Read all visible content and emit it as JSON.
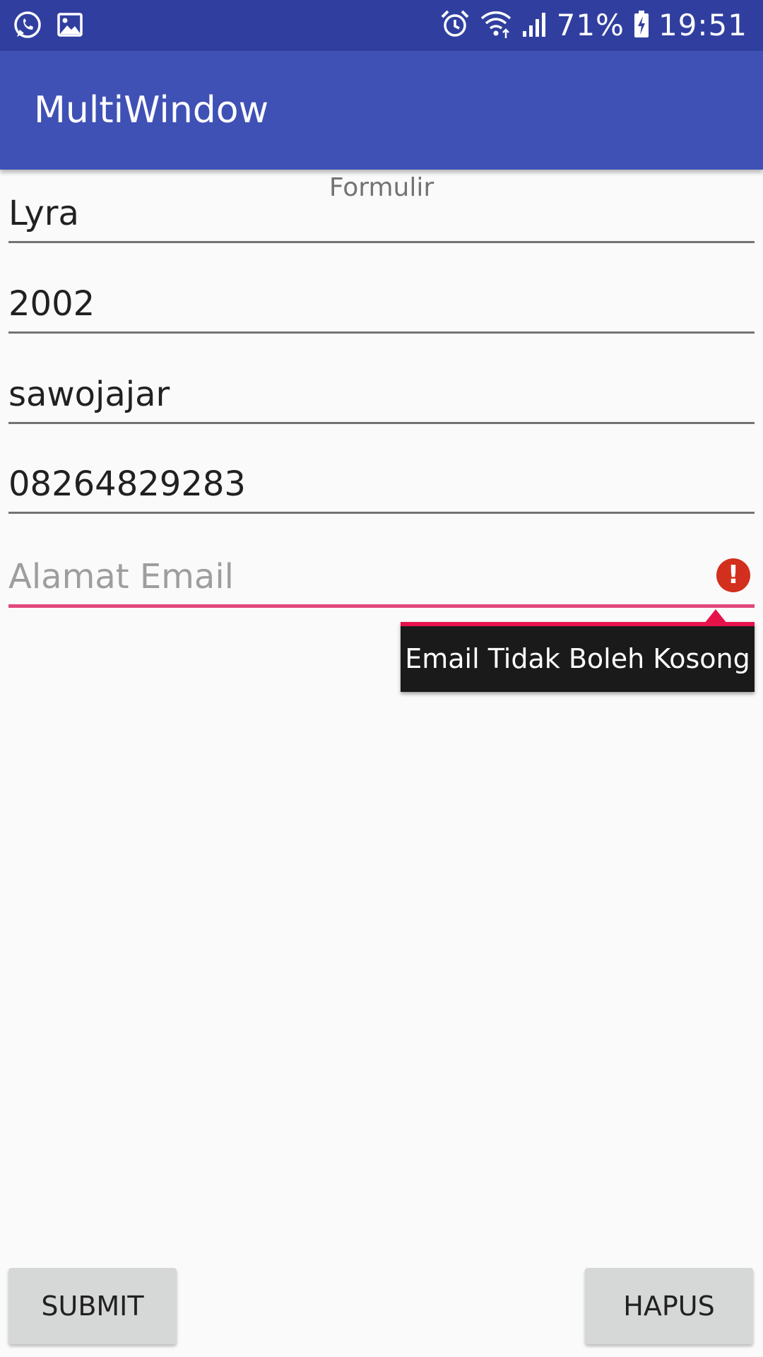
{
  "status_bar": {
    "left_icons": [
      "whatsapp-icon",
      "gallery-icon"
    ],
    "right_icons": [
      "alarm-icon",
      "wifi-icon",
      "signal-icon",
      "battery-charging-icon"
    ],
    "battery_percent": "71%",
    "time": "19:51"
  },
  "app_bar": {
    "title": "MultiWindow"
  },
  "form": {
    "heading": "Formulir",
    "fields": [
      {
        "value": "Lyra"
      },
      {
        "value": "2002"
      },
      {
        "value": "sawojajar"
      },
      {
        "value": "08264829283"
      },
      {
        "value": "",
        "placeholder": "Alamat Email",
        "error": true
      }
    ],
    "error_message": "Email Tidak Boleh Kosong",
    "error_icon": "!"
  },
  "buttons": {
    "submit_label": "SUBMIT",
    "hapus_label": "HAPUS"
  },
  "colors": {
    "status_bar": "#303f9f",
    "app_bar": "#3f51b5",
    "error_underline": "#e2487a",
    "error_accent": "#e8124a",
    "error_icon": "#d32f1e",
    "background": "#fafafa"
  }
}
